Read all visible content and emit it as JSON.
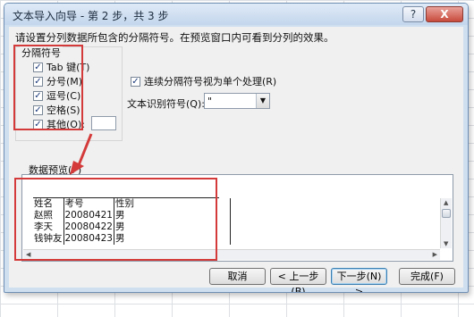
{
  "window": {
    "title": "文本导入向导 - 第 2 步，共 3 步",
    "help": "?",
    "close": "X"
  },
  "instruction": "请设置分列数据所包含的分隔符号。在预览窗口内可看到分列的效果。",
  "delimiters": {
    "group_label": "分隔符号",
    "items": [
      {
        "label": "Tab 键(T)",
        "checked": true
      },
      {
        "label": "分号(M)",
        "checked": true
      },
      {
        "label": "逗号(C)",
        "checked": true
      },
      {
        "label": "空格(S)",
        "checked": true
      },
      {
        "label": "其他(O):",
        "checked": true
      }
    ],
    "other_value": ""
  },
  "consecutive": {
    "label": "连续分隔符号视为单个处理(R)",
    "checked": true
  },
  "qualifier": {
    "label": "文本识别符号(Q):",
    "value": "\""
  },
  "preview": {
    "label": "数据预览(P)",
    "rows": [
      [
        "姓名",
        "考号",
        "性别"
      ],
      [
        "赵照",
        "20080421",
        "男"
      ],
      [
        "李天",
        "20080422",
        "男"
      ],
      [
        "钱钟友",
        "20080423",
        "男"
      ]
    ]
  },
  "buttons": {
    "cancel": "取消",
    "back": "< 上一步(B)",
    "next": "下一步(N) >",
    "finish": "完成(F)"
  },
  "colors": {
    "annotation": "#d43a3a",
    "title_bar": "#c3d6ec"
  },
  "icons": [
    "help-icon",
    "close-icon",
    "dropdown-arrow-icon",
    "scroll-up-icon",
    "scroll-down-icon",
    "scroll-left-icon",
    "scroll-right-icon"
  ]
}
